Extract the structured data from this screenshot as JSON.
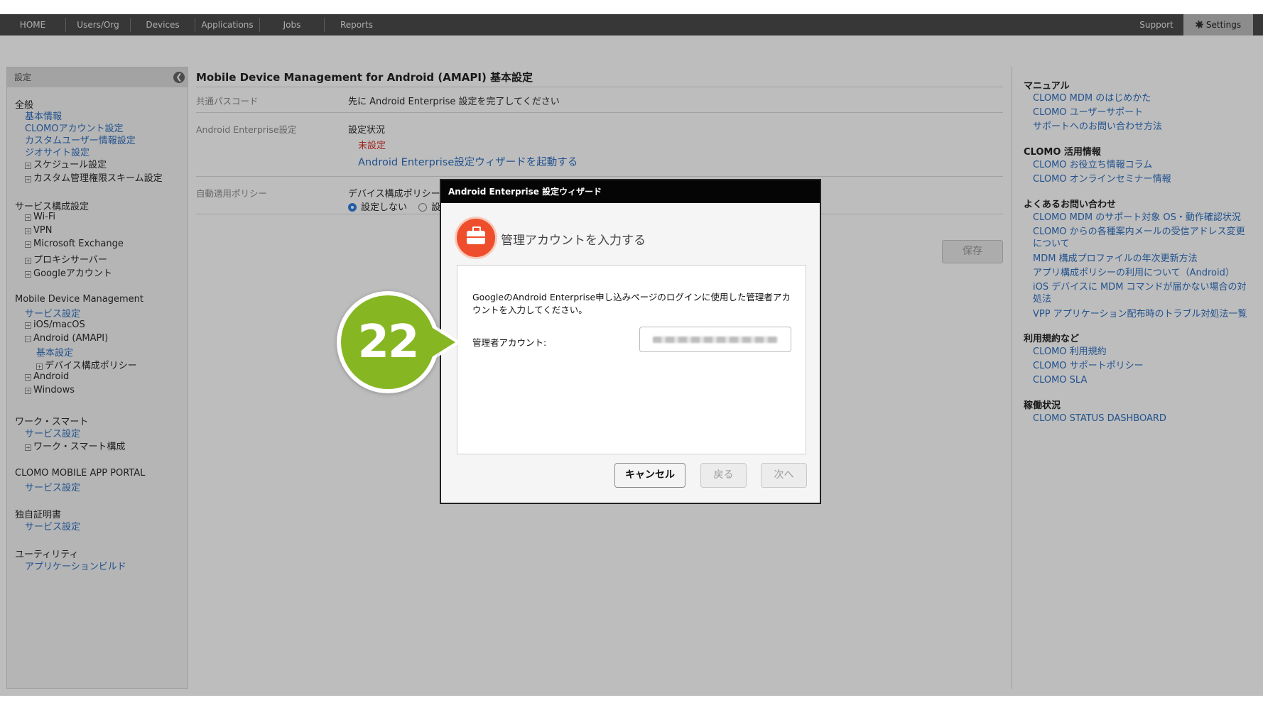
{
  "nav": {
    "tabs": [
      "HOME",
      "Users/Org",
      "Devices",
      "Applications",
      "Jobs",
      "Reports"
    ],
    "support": "Support",
    "settings": "Settings"
  },
  "sidebar": {
    "header": "設定",
    "groups": [
      {
        "title": "全般",
        "items": [
          {
            "kind": "link",
            "text": "基本情報"
          },
          {
            "kind": "link",
            "text": "CLOMOアカウント設定"
          },
          {
            "kind": "link",
            "text": "カスタムユーザー情報設定"
          },
          {
            "kind": "link",
            "text": "ジオサイト設定"
          },
          {
            "kind": "tree",
            "text": "スケジュール設定"
          },
          {
            "kind": "tree",
            "text": "カスタム管理権限スキーム設定"
          }
        ]
      },
      {
        "title": "サービス構成設定",
        "items": [
          {
            "kind": "tree",
            "text": "Wi-Fi"
          },
          {
            "kind": "tree",
            "text": "VPN"
          },
          {
            "kind": "tree",
            "text": "Microsoft Exchange"
          },
          {
            "kind": "tree",
            "text": "プロキシサーバー"
          },
          {
            "kind": "tree",
            "text": "Googleアカウント"
          }
        ]
      },
      {
        "title": "Mobile Device Management",
        "items": [
          {
            "kind": "link",
            "text": "サービス設定"
          },
          {
            "kind": "tree",
            "text": "iOS/macOS"
          },
          {
            "kind": "tree-open",
            "text": "Android (AMAPI)"
          },
          {
            "kind": "link2",
            "text": "基本設定"
          },
          {
            "kind": "tree2",
            "text": "デバイス構成ポリシー"
          },
          {
            "kind": "tree",
            "text": "Android"
          },
          {
            "kind": "tree",
            "text": "Windows"
          }
        ]
      },
      {
        "title": "ワーク・スマート",
        "items": [
          {
            "kind": "link",
            "text": "サービス設定"
          },
          {
            "kind": "tree",
            "text": "ワーク・スマート構成"
          }
        ]
      },
      {
        "title": "CLOMO MOBILE APP PORTAL",
        "items": [
          {
            "kind": "link",
            "text": "サービス設定"
          }
        ]
      },
      {
        "title": "独自証明書",
        "items": [
          {
            "kind": "link",
            "text": "サービス設定"
          }
        ]
      },
      {
        "title": "ユーティリティ",
        "items": [
          {
            "kind": "link",
            "text": "アプリケーションビルド"
          }
        ]
      }
    ]
  },
  "main": {
    "title": "Mobile Device Management for Android (AMAPI) 基本設定",
    "passcode_label": "共通パスコード",
    "passcode_value": "先に Android Enterprise 設定を完了してください",
    "ae_label": "Android Enterprise設定",
    "ae_status_label": "設定状況",
    "ae_status_value": "未設定",
    "ae_wizard_link": "Android Enterprise設定ウィザードを起動する",
    "policy_label": "自動適用ポリシー",
    "policy_field": "デバイス構成ポリシー",
    "policy_opt1": "設定しない",
    "policy_opt2": "設",
    "save": "保存"
  },
  "right": {
    "sections": [
      {
        "title": "マニュアル",
        "links": [
          "CLOMO MDM のはじめかた",
          "CLOMO ユーザーサポート",
          "サポートへのお問い合わせ方法"
        ]
      },
      {
        "title": "CLOMO 活用情報",
        "links": [
          "CLOMO お役立ち情報コラム",
          "CLOMO オンラインセミナー情報"
        ]
      },
      {
        "title": "よくあるお問い合わせ",
        "links": [
          "CLOMO MDM のサポート対象 OS・動作確認状況",
          "CLOMO からの各種案内メールの受信アドレス変更について",
          "MDM 構成プロファイルの年次更新方法",
          "アプリ構成ポリシーの利用について（Android）",
          "iOS デバイスに MDM コマンドが届かない場合の対処法",
          "VPP アプリケーション配布時のトラブル対処法一覧"
        ]
      },
      {
        "title": "利用規約など",
        "links": [
          "CLOMO 利用規約",
          "CLOMO サポートポリシー",
          "CLOMO SLA"
        ]
      },
      {
        "title": "稼働状況",
        "links": [
          "CLOMO STATUS DASHBOARD"
        ]
      }
    ]
  },
  "modal": {
    "header": "Android Enterprise 設定ウィザード",
    "title": "管理アカウントを入力する",
    "description": "GoogleのAndroid Enterprise申し込みページのログインに使用した管理者アカウントを入力してください。",
    "account_label": "管理者アカウント:",
    "cancel": "キャンセル",
    "back": "戻る",
    "next": "次へ"
  },
  "badge": {
    "number": "22"
  },
  "colors": {
    "accent_blue": "#2e6fc0",
    "badge_green": "#86b723",
    "icon_orange": "#ee4e2b",
    "status_red": "#d9342b"
  }
}
